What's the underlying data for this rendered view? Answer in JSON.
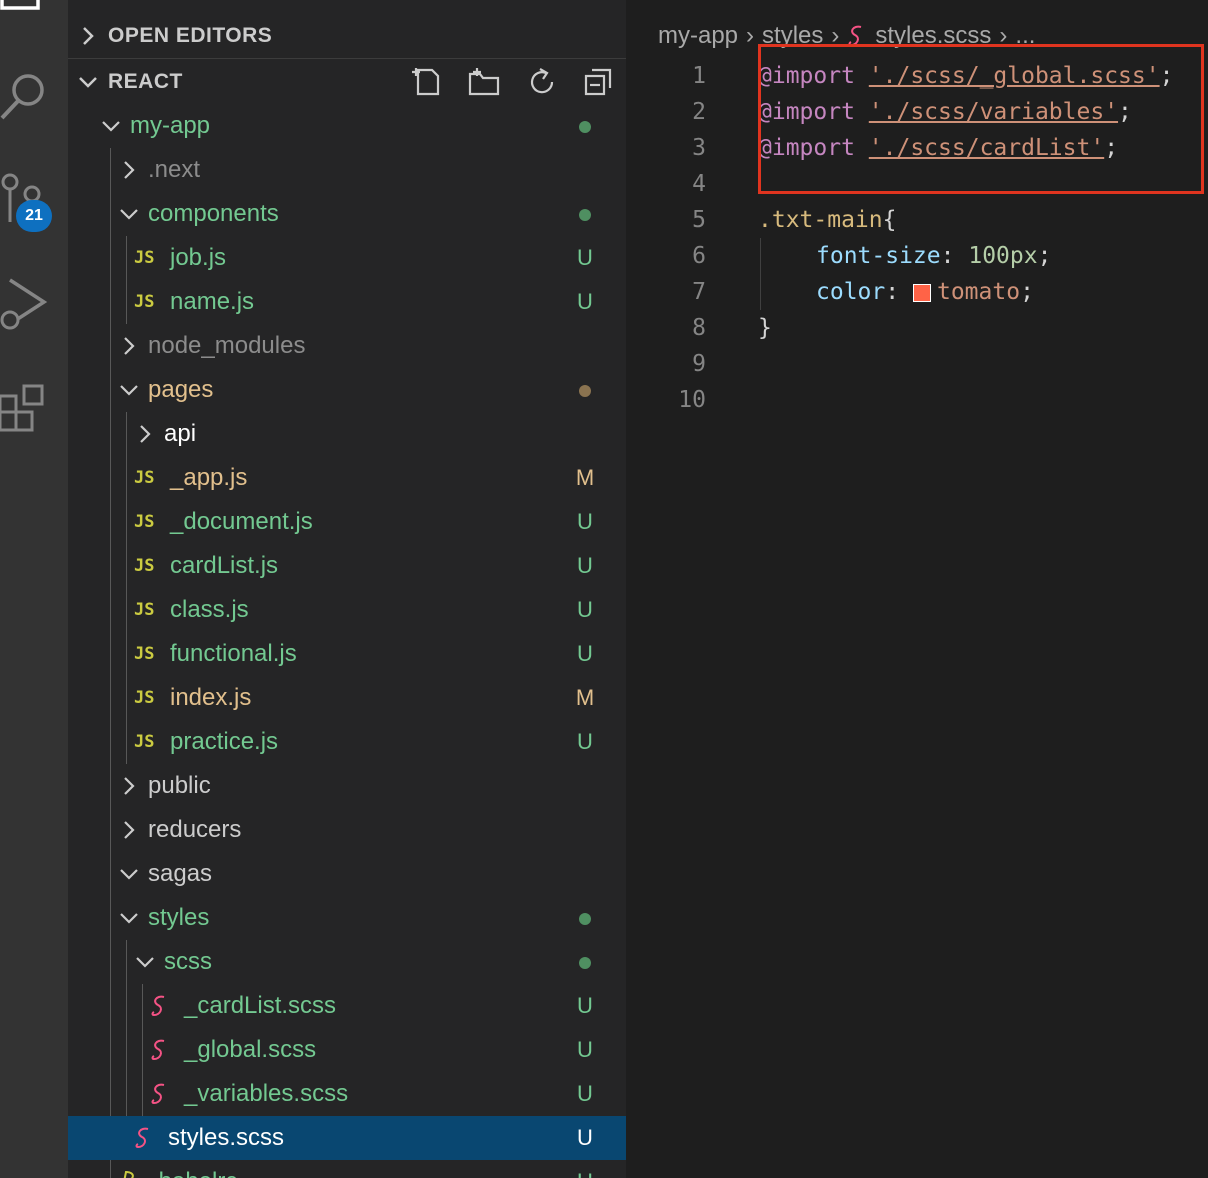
{
  "activity_bar": {
    "icons": [
      "explorer-icon",
      "search-icon",
      "source-control-icon",
      "run-debug-icon",
      "extensions-icon"
    ],
    "scm_badge": "21"
  },
  "sidebar": {
    "open_editors_label": "OPEN EDITORS",
    "workspace_label": "REACT",
    "toolbar": [
      "new-file-icon",
      "new-folder-icon",
      "refresh-icon",
      "collapse-all-icon"
    ],
    "tree": [
      {
        "name": "my-app",
        "status": "",
        "dot": "#4f8f61"
      },
      {
        "name": ".next",
        "status": ""
      },
      {
        "name": "components",
        "status": "",
        "dot": "#4f8f61"
      },
      {
        "name": "job.js",
        "status": "U"
      },
      {
        "name": "name.js",
        "status": "U"
      },
      {
        "name": "node_modules",
        "status": ""
      },
      {
        "name": "pages",
        "status": "",
        "dot": "#8a7350"
      },
      {
        "name": "api",
        "status": ""
      },
      {
        "name": "_app.js",
        "status": "M"
      },
      {
        "name": "_document.js",
        "status": "U"
      },
      {
        "name": "cardList.js",
        "status": "U"
      },
      {
        "name": "class.js",
        "status": "U"
      },
      {
        "name": "functional.js",
        "status": "U"
      },
      {
        "name": "index.js",
        "status": "M"
      },
      {
        "name": "practice.js",
        "status": "U"
      },
      {
        "name": "public",
        "status": ""
      },
      {
        "name": "reducers",
        "status": ""
      },
      {
        "name": "sagas",
        "status": ""
      },
      {
        "name": "styles",
        "status": "",
        "dot": "#4f8f61"
      },
      {
        "name": "scss",
        "status": "",
        "dot": "#4f8f61"
      },
      {
        "name": "_cardList.scss",
        "status": "U"
      },
      {
        "name": "_global.scss",
        "status": "U"
      },
      {
        "name": "_variables.scss",
        "status": "U"
      },
      {
        "name": "styles.scss",
        "status": "U"
      },
      {
        "name": ".babelrc",
        "status": "U"
      }
    ]
  },
  "editor": {
    "breadcrumb": [
      "my-app",
      "styles",
      "styles.scss",
      "..."
    ],
    "line_numbers": [
      "1",
      "2",
      "3",
      "4",
      "5",
      "6",
      "7",
      "8",
      "9",
      "10"
    ],
    "code": {
      "l1_kw": "@import",
      "l1_str": "'./scss/_global.scss'",
      "l1_end": ";",
      "l2_kw": "@import",
      "l2_str": "'./scss/variables'",
      "l2_end": ";",
      "l3_kw": "@import",
      "l3_str": "'./scss/cardList'",
      "l3_end": ";",
      "l5_sel": ".txt-main",
      "l5_brace": "{",
      "l6_prop": "font-size",
      "l6_colon": ":",
      "l6_num": "100px",
      "l6_end": ";",
      "l7_prop": "color",
      "l7_colon": ":",
      "l7_val": "tomato",
      "l7_end": ";",
      "l8_brace": "}"
    },
    "swatch_color": "#ff6347",
    "highlight_color": "#e0341f"
  }
}
